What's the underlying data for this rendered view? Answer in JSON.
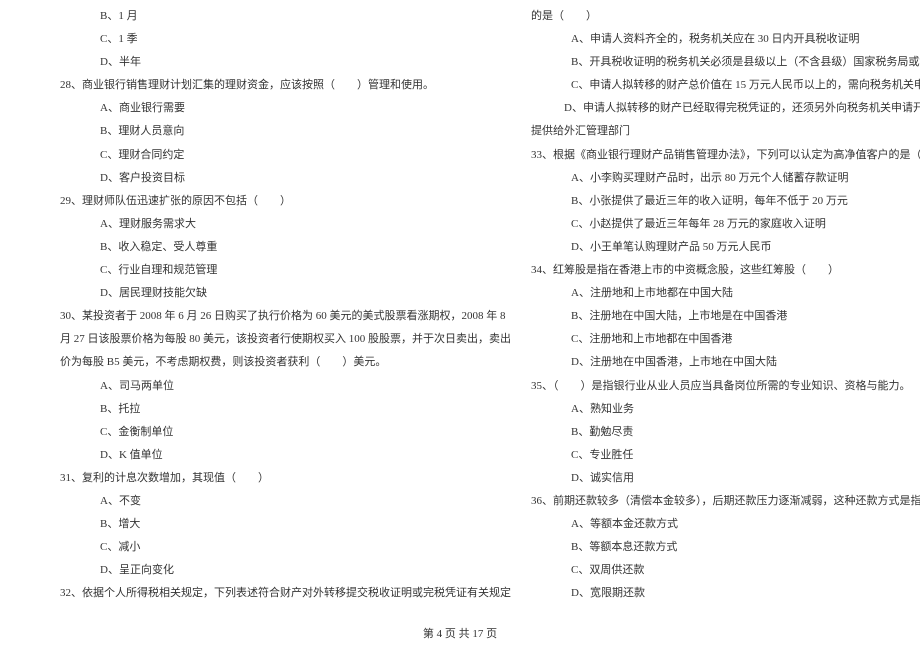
{
  "left": {
    "opts_pre": [
      "B、1 月",
      "C、1 季",
      "D、半年"
    ],
    "q28": "28、商业银行销售理财计划汇集的理财资金，应该按照（　　）管理和使用。",
    "q28_opts": [
      "A、商业银行需要",
      "B、理财人员意向",
      "C、理财合同约定",
      "D、客户投资目标"
    ],
    "q29": "29、理财师队伍迅速扩张的原因不包括（　　）",
    "q29_opts": [
      "A、理财服务需求大",
      "B、收入稳定、受人尊重",
      "C、行业自理和规范管理",
      "D、居民理财技能欠缺"
    ],
    "q30_l1": "30、某投资者于 2008 年 6 月 26 日购买了执行价格为 60 美元的美式股票看涨期权，2008 年 8",
    "q30_l2": "月 27 日该股票价格为每股 80 美元，该投资者行使期权买入 100 股股票，并于次日卖出，卖出",
    "q30_l3": "价为每股 B5 美元，不考虑期权费，则该投资者获利（　　）美元。",
    "q30_opts": [
      "A、司马两单位",
      "B、托拉",
      "C、金衡制单位",
      "D、K 值单位"
    ],
    "q31": "31、复利的计息次数增加，其现值（　　）",
    "q31_opts": [
      "A、不变",
      "B、增大",
      "C、减小",
      "D、呈正向变化"
    ],
    "q32": "32、依据个人所得税相关规定，下列表述符合财产对外转移提交税收证明或完税凭证有关规定"
  },
  "right": {
    "q32_cont": "的是（　　）",
    "q32_opts": [
      "A、申请人资料齐全的，税务机关应在 30 日内开具税收证明",
      "B、开具税收证明的税务机关必须是县级以上（不含县级）国家税务局或地方税务局",
      "C、申请人拟转移的财产总价值在 15 万元人民币以上的，需向税务机关申请税收证明"
    ],
    "q32_d_l1": "　　　D、申请人拟转移的财产已经取得完税凭证的，还须另外向税务机关申请开具税收证明，并",
    "q32_d_l2": "提供给外汇管理部门",
    "q33": "33、根据《商业银行理财产品销售管理办法》，下列可以认定为高净值客户的是（　　）",
    "q33_opts": [
      "A、小李购买理财产品时，出示 80 万元个人储蓄存款证明",
      "B、小张提供了最近三年的收入证明，每年不低于 20 万元",
      "C、小赵提供了最近三年每年 28 万元的家庭收入证明",
      "D、小王单笔认购理财产品 50 万元人民币"
    ],
    "q34": "34、红筹股是指在香港上市的中资概念股，这些红筹股（　　）",
    "q34_opts": [
      "A、注册地和上市地都在中国大陆",
      "B、注册地在中国大陆，上市地是在中国香港",
      "C、注册地和上市地都在中国香港",
      "D、注册地在中国香港，上市地在中国大陆"
    ],
    "q35": "35、（　　）是指银行业从业人员应当具备岗位所需的专业知识、资格与能力。",
    "q35_opts": [
      "A、熟知业务",
      "B、勤勉尽责",
      "C、专业胜任",
      "D、诚实信用"
    ],
    "q36": "36、前期还款较多（清偿本金较多），后期还款压力逐渐减弱，这种还款方式是指（　　）",
    "q36_opts": [
      "A、等额本金还款方式",
      "B、等额本息还款方式",
      "C、双周供还款",
      "D、宽限期还款"
    ]
  },
  "footer": {
    "prefix": "第 ",
    "page": "4",
    "mid": " 页 共 ",
    "total": "17",
    "suffix": " 页"
  }
}
